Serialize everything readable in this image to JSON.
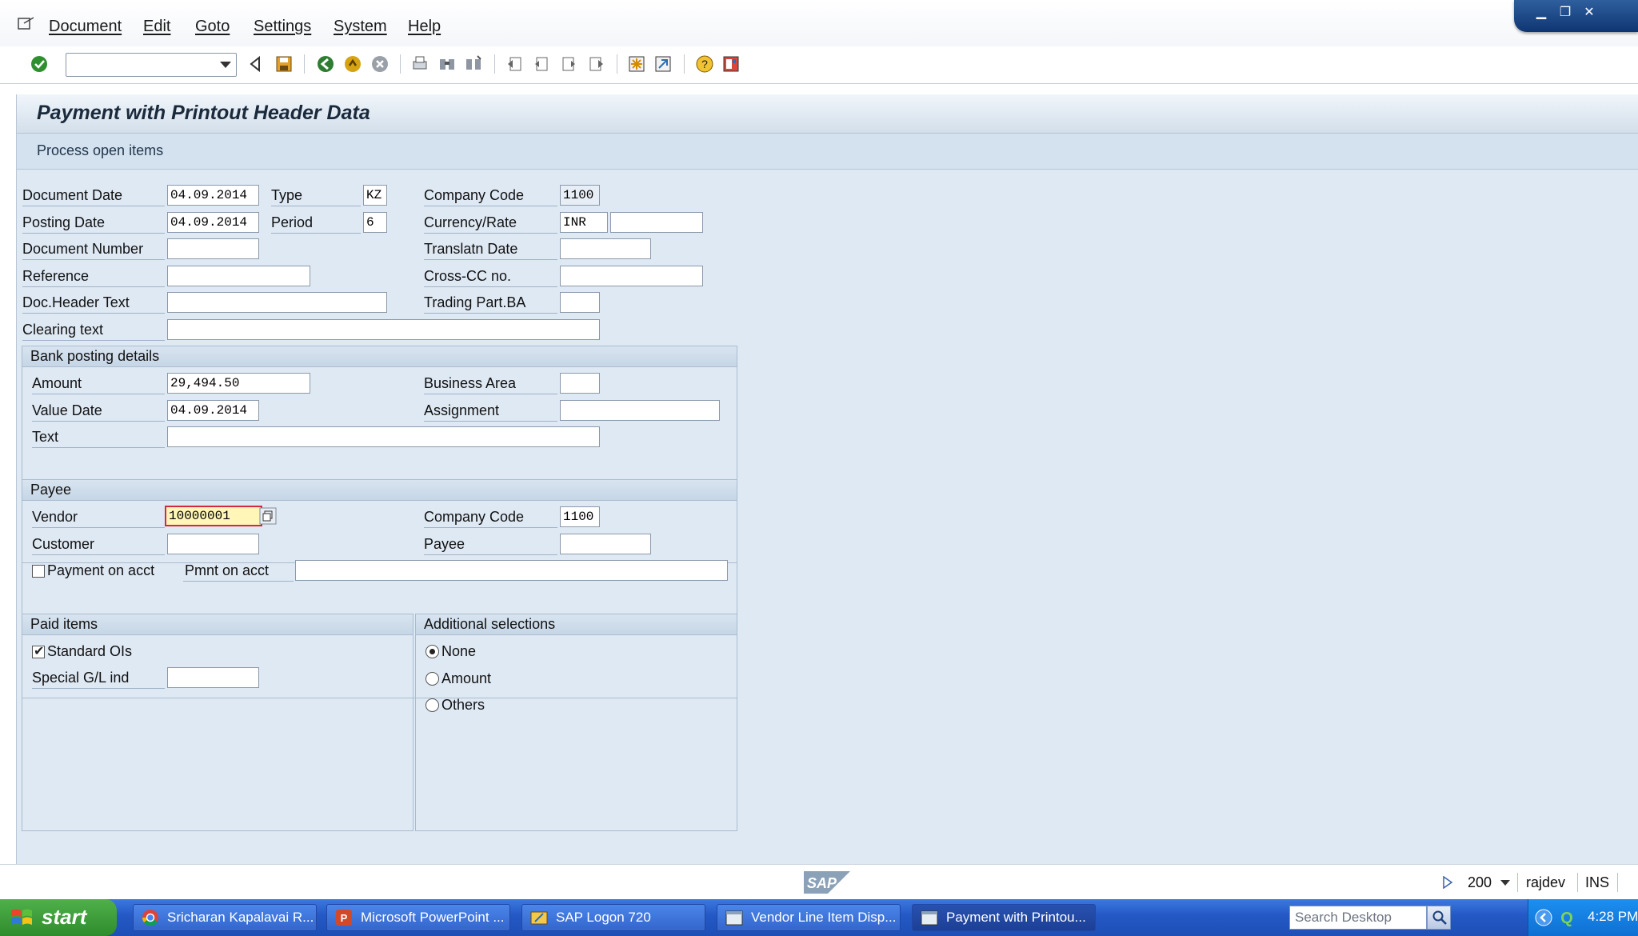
{
  "menu": {
    "items": [
      "Document",
      "Edit",
      "Goto",
      "Settings",
      "System",
      "Help"
    ]
  },
  "toolbar": {
    "command_field_value": ""
  },
  "page": {
    "title": "Payment with Printout Header Data",
    "app_button": "Process open items"
  },
  "header": {
    "document_date_label": "Document Date",
    "document_date": "04.09.2014",
    "type_label": "Type",
    "type": "KZ",
    "company_code_label": "Company Code",
    "company_code": "1100",
    "posting_date_label": "Posting Date",
    "posting_date": "04.09.2014",
    "period_label": "Period",
    "period": "6",
    "currency_rate_label": "Currency/Rate",
    "currency": "INR",
    "rate": "",
    "document_number_label": "Document Number",
    "document_number": "",
    "translatn_date_label": "Translatn Date",
    "translatn_date": "",
    "reference_label": "Reference",
    "reference": "",
    "cross_cc_label": "Cross-CC no.",
    "cross_cc": "",
    "doc_header_text_label": "Doc.Header Text",
    "doc_header_text": "",
    "trading_part_label": "Trading Part.BA",
    "trading_part": "",
    "clearing_text_label": "Clearing text",
    "clearing_text": ""
  },
  "bank": {
    "title": "Bank posting details",
    "amount_label": "Amount",
    "amount": "29,494.50",
    "business_area_label": "Business Area",
    "business_area": "",
    "value_date_label": "Value Date",
    "value_date": "04.09.2014",
    "assignment_label": "Assignment",
    "assignment": "",
    "text_label": "Text",
    "text": ""
  },
  "payee": {
    "title": "Payee",
    "vendor_label": "Vendor",
    "vendor": "10000001",
    "company_code_label": "Company Code",
    "company_code": "1100",
    "customer_label": "Customer",
    "customer": "",
    "payee_label": "Payee",
    "payee": "",
    "payment_on_acct_label": "Payment on acct",
    "payment_on_acct_checked": false,
    "pmnt_on_acct_label": "Pmnt on acct",
    "pmnt_on_acct": ""
  },
  "paid_items": {
    "title": "Paid items",
    "standard_ois_label": "Standard OIs",
    "standard_ois_checked": true,
    "special_gl_label": "Special G/L ind",
    "special_gl": ""
  },
  "additional": {
    "title": "Additional selections",
    "options": [
      "None",
      "Amount",
      "Others"
    ],
    "selected": "None"
  },
  "status": {
    "client": "200",
    "user": "rajdev",
    "mode": "INS"
  },
  "taskbar": {
    "start_label": "start",
    "tasks": [
      "Sricharan Kapalavai R...",
      "Microsoft PowerPoint ...",
      "SAP Logon 720",
      "Vendor Line Item Disp...",
      "Payment with Printou..."
    ],
    "search_placeholder": "Search Desktop",
    "clock": "4:28 PM"
  },
  "colors": {
    "content_bg": "#dfe9f4",
    "active_field_bg": "#fff6b8",
    "active_field_border": "#d7263d",
    "taskbar_blue": "#2458c4",
    "start_green": "#3a9a37"
  }
}
